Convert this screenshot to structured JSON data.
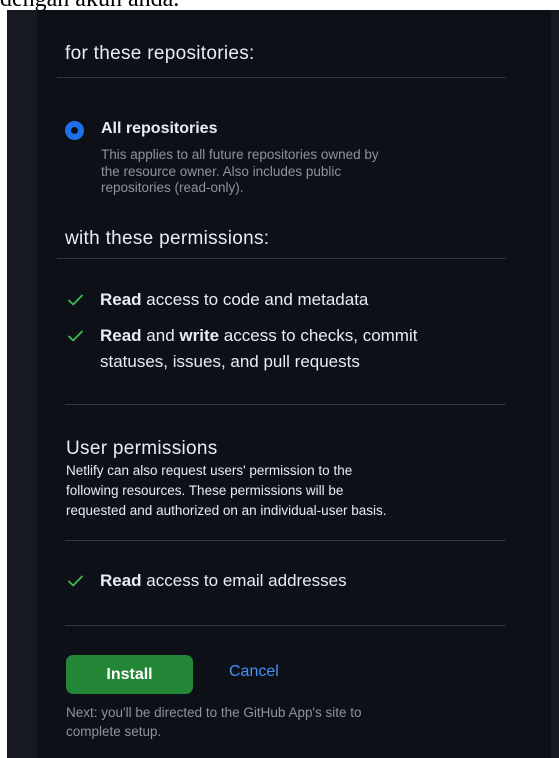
{
  "top_clip_text": "dengan akun anda.",
  "repositories": {
    "heading": "for these repositories:",
    "option": {
      "title": "All repositories",
      "desc_lines": [
        "This applies to all future repositories owned by",
        "the resource owner. Also includes public",
        "repositories (read-only)."
      ]
    }
  },
  "permissions": {
    "heading": "with these permissions:",
    "items": [
      {
        "bold": "Read",
        "rest": " access to code and metadata"
      },
      {
        "bold": "Read",
        "mid": " and ",
        "bold2": "write",
        "rest": " access to checks, commit",
        "line2": "statuses, issues, and pull requests"
      }
    ]
  },
  "user_permissions": {
    "heading": "User permissions",
    "desc_lines": [
      "Netlify can also request users' permission to the",
      "following resources. These permissions will be",
      "requested and authorized on an individual-user basis."
    ],
    "items": [
      {
        "bold": "Read",
        "rest": " access to email addresses"
      }
    ]
  },
  "actions": {
    "install_label": "Install",
    "cancel_label": "Cancel",
    "note_lines": [
      "Next: you'll be directed to the GitHub App's site to",
      "complete setup."
    ]
  },
  "colors": {
    "background": "#0d1117",
    "accent_blue": "#1f6feb",
    "success_green": "#238636",
    "check_green": "#3fb950"
  }
}
